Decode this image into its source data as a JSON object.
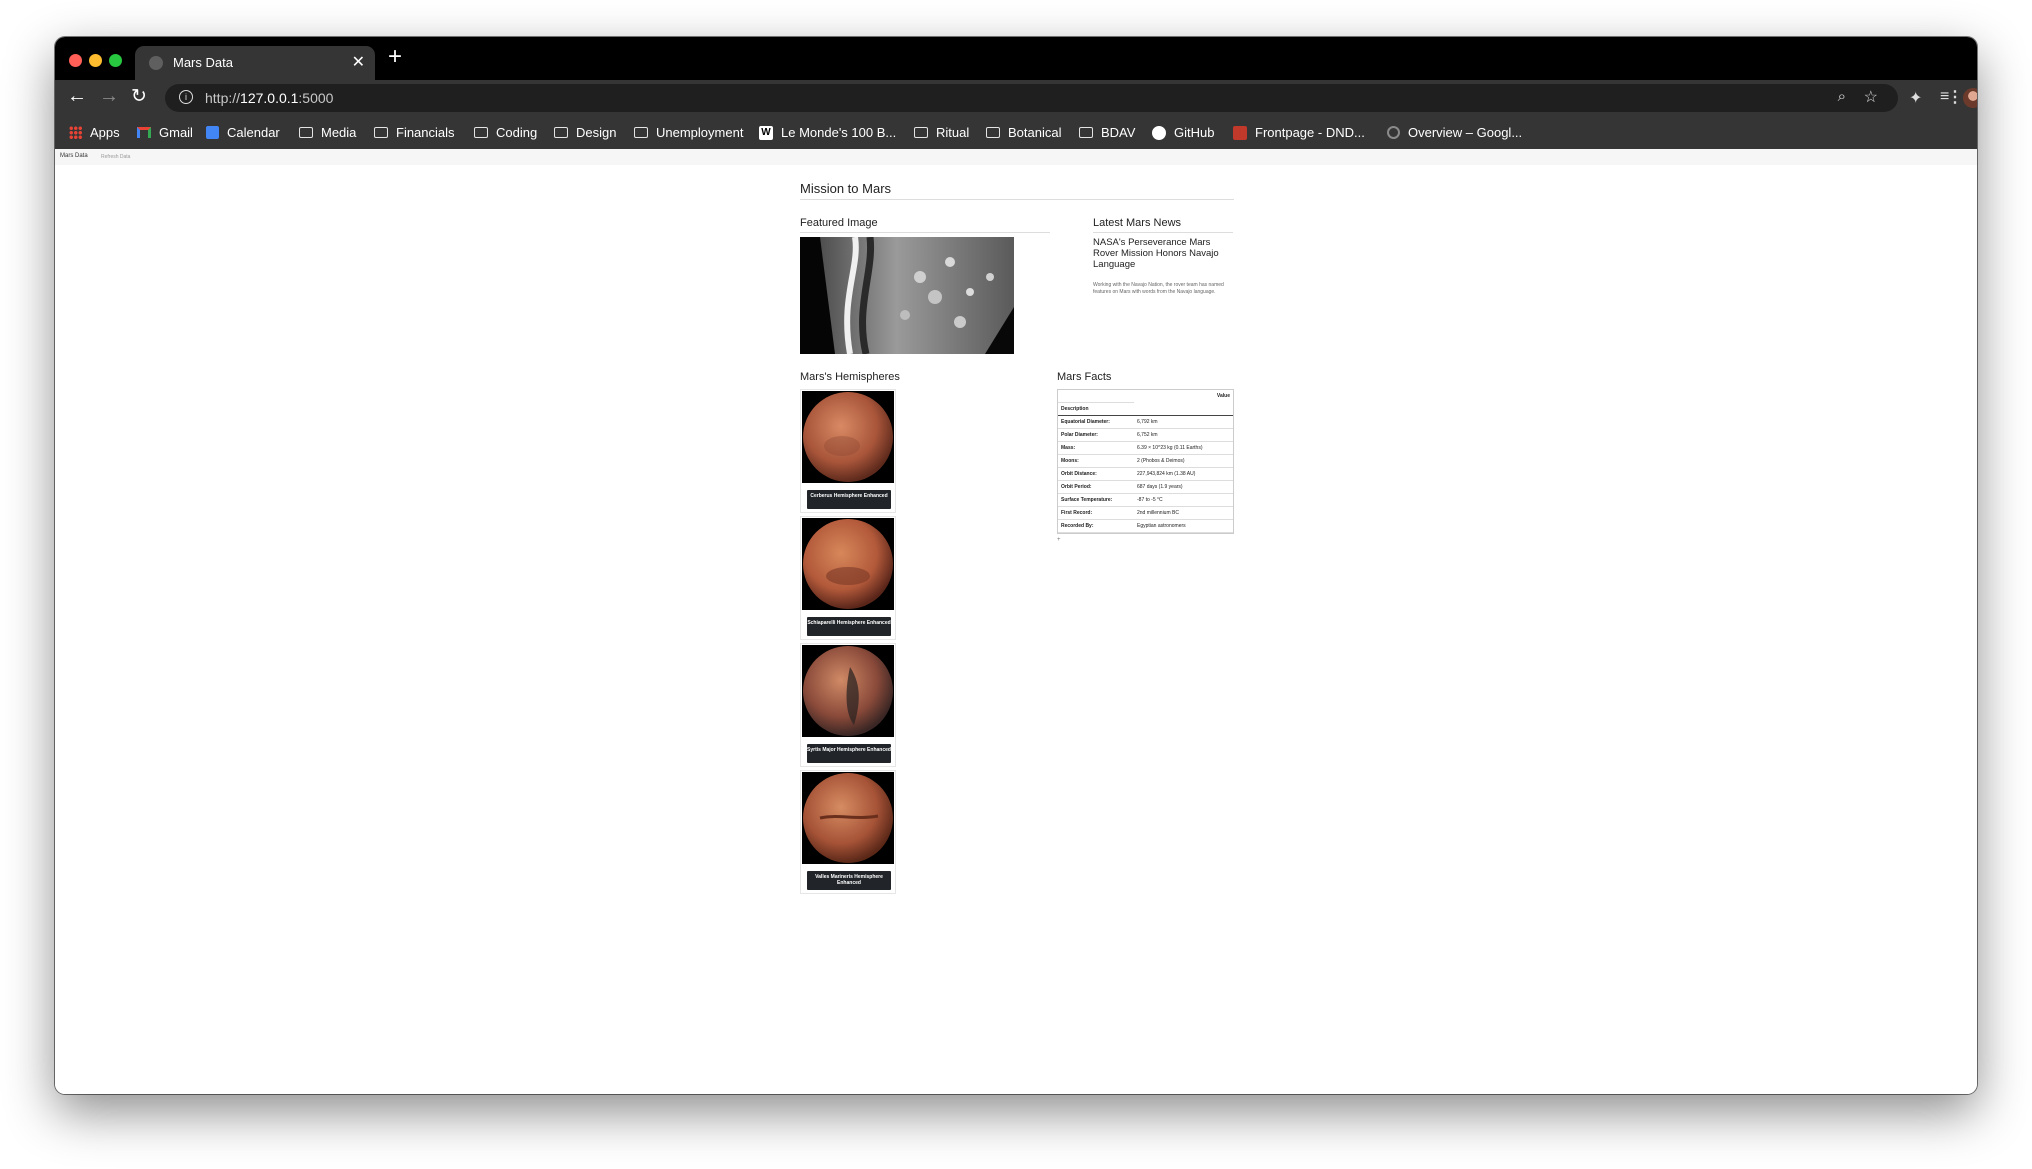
{
  "browser": {
    "tab_title": "Mars Data",
    "tab_close": "✕",
    "new_tab": "+",
    "url_prefix": "http://",
    "url_host": "127.0.0.1",
    "url_port": ":5000",
    "nav_back": "←",
    "nav_forward": "→",
    "nav_reload": "↻",
    "bookmarks": [
      {
        "label": "Apps",
        "icon": "apps-icon"
      },
      {
        "label": "Gmail",
        "icon": "gmail-icon"
      },
      {
        "label": "Calendar",
        "icon": "calendar-icon"
      },
      {
        "label": "Media",
        "icon": "folder-icon"
      },
      {
        "label": "Financials",
        "icon": "folder-icon"
      },
      {
        "label": "Coding",
        "icon": "folder-icon"
      },
      {
        "label": "Design",
        "icon": "folder-icon"
      },
      {
        "label": "Unemployment",
        "icon": "folder-icon"
      },
      {
        "label": "Le Monde's 100 B...",
        "icon": "wikipedia-icon"
      },
      {
        "label": "Ritual",
        "icon": "folder-icon"
      },
      {
        "label": "Botanical",
        "icon": "folder-icon"
      },
      {
        "label": "BDAV",
        "icon": "folder-icon"
      },
      {
        "label": "GitHub",
        "icon": "github-icon"
      },
      {
        "label": "Frontpage - DND...",
        "icon": "dnd-icon"
      },
      {
        "label": "Overview – Googl...",
        "icon": "overview-icon"
      }
    ]
  },
  "page": {
    "navbar": {
      "brand": "Mars Data",
      "refresh": "Refresh Data"
    },
    "title": "Mission to Mars",
    "featured": {
      "heading": "Featured Image"
    },
    "news": {
      "heading": "Latest Mars News",
      "title": "NASA's Perseverance Mars Rover Mission Honors Navajo Language",
      "paragraph": "Working with the Navajo Nation, the rover team has named features on Mars with words from the Navajo language."
    },
    "hemispheres": {
      "heading": "Mars's Hemispheres",
      "items": [
        {
          "caption": "Cerberus Hemisphere Enhanced",
          "style": "cerberus"
        },
        {
          "caption": "Schiaparelli Hemisphere Enhanced",
          "style": "schiaparelli"
        },
        {
          "caption": "Syrtis Major Hemisphere Enhanced",
          "style": "syrtis"
        },
        {
          "caption": "Valles Marineris Hemisphere Enhanced",
          "style": "valles"
        }
      ]
    },
    "facts": {
      "heading": "Mars Facts",
      "value_header": "Value",
      "desc_header": "Description",
      "rows": [
        {
          "label": "Equatorial Diameter:",
          "value": "6,792 km"
        },
        {
          "label": "Polar Diameter:",
          "value": "6,752 km"
        },
        {
          "label": "Mass:",
          "value": "6.39 × 10^23 kg (0.11 Earths)"
        },
        {
          "label": "Moons:",
          "value": "2 (Phobos & Deimos)"
        },
        {
          "label": "Orbit Distance:",
          "value": "227,943,824 km (1.38 AU)"
        },
        {
          "label": "Orbit Period:",
          "value": "687 days (1.9 years)"
        },
        {
          "label": "Surface Temperature:",
          "value": "-87 to -5 °C"
        },
        {
          "label": "First Record:",
          "value": "2nd millennium BC"
        },
        {
          "label": "Recorded By:",
          "value": "Egyptian astronomers"
        }
      ],
      "footnote": "+"
    }
  }
}
